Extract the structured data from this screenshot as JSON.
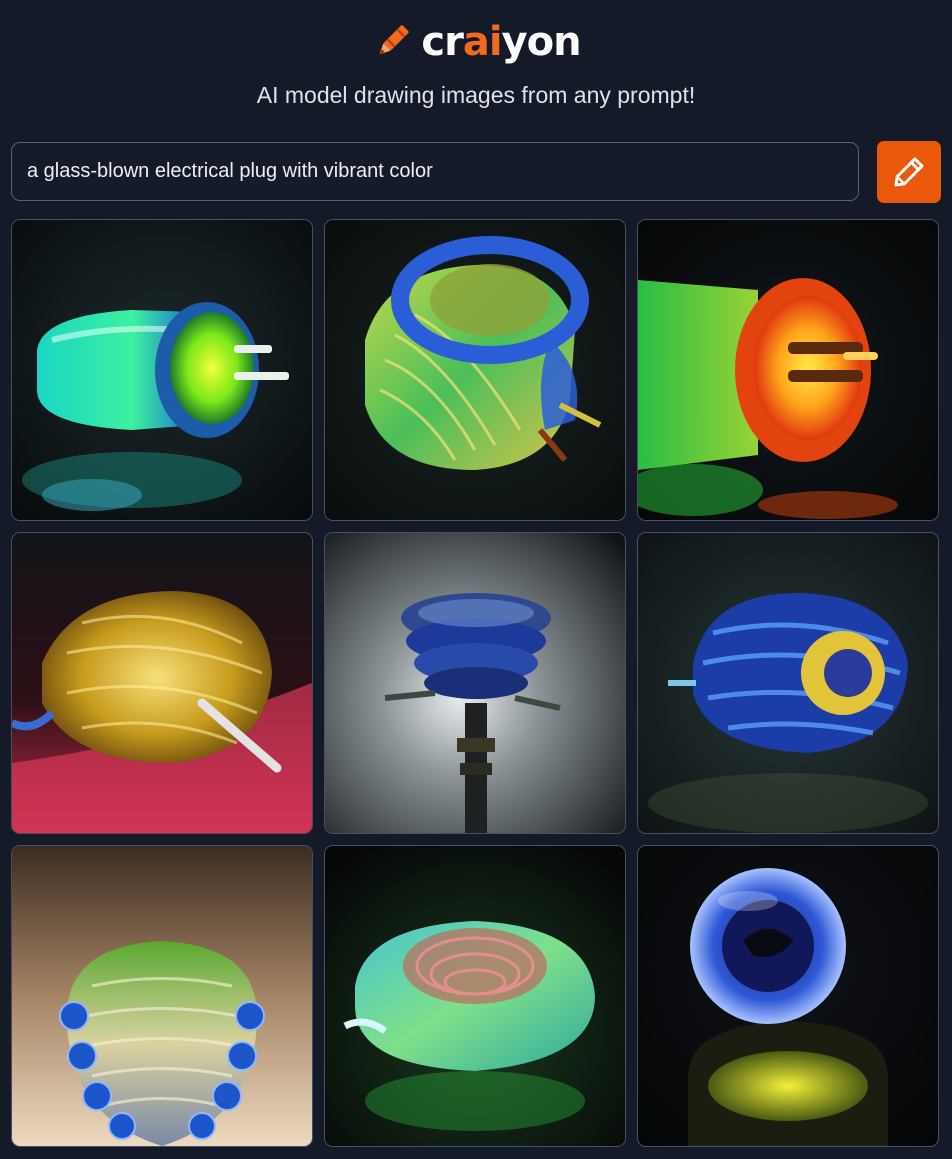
{
  "brand": {
    "name_prefix": "cr",
    "name_accent": "ai",
    "name_suffix": "yon",
    "accent_color": "#f26a1b",
    "icon": "crayon-icon"
  },
  "tagline": "AI model drawing images from any prompt!",
  "prompt": {
    "value": "a glass-blown electrical plug with vibrant color",
    "submit_icon": "pencil-icon",
    "button_color": "#ea580c"
  },
  "results": [
    {
      "subject": "generated image 1"
    },
    {
      "subject": "generated image 2"
    },
    {
      "subject": "generated image 3"
    },
    {
      "subject": "generated image 4"
    },
    {
      "subject": "generated image 5"
    },
    {
      "subject": "generated image 6"
    },
    {
      "subject": "generated image 7"
    },
    {
      "subject": "generated image 8"
    },
    {
      "subject": "generated image 9"
    }
  ]
}
